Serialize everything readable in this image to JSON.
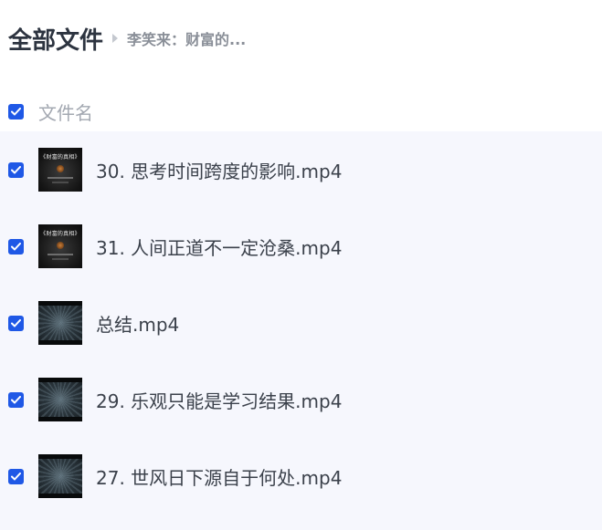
{
  "breadcrumb": {
    "root": "全部文件",
    "separator_icon": "caret-right-icon",
    "current": "李笑来：财富的..."
  },
  "list_header": {
    "select_all_checked": true,
    "column_name": "文件名"
  },
  "files": [
    {
      "name": "30. 思考时间跨度的影响.mp4",
      "checked": true,
      "thumbnail": "cover",
      "cover_title": "《财富的真相》"
    },
    {
      "name": "31. 人间正道不一定沧桑.mp4",
      "checked": true,
      "thumbnail": "cover",
      "cover_title": "《财富的真相》"
    },
    {
      "name": "总结.mp4",
      "checked": true,
      "thumbnail": "rays"
    },
    {
      "name": "29. 乐观只能是学习结果.mp4",
      "checked": true,
      "thumbnail": "rays"
    },
    {
      "name": "27. 世风日下源自于何处.mp4",
      "checked": true,
      "thumbnail": "rays"
    }
  ],
  "colors": {
    "accent": "#1f58e6",
    "list_background": "#f6f7fd",
    "title_text": "#2d3440",
    "muted_text": "#8a8f98"
  }
}
